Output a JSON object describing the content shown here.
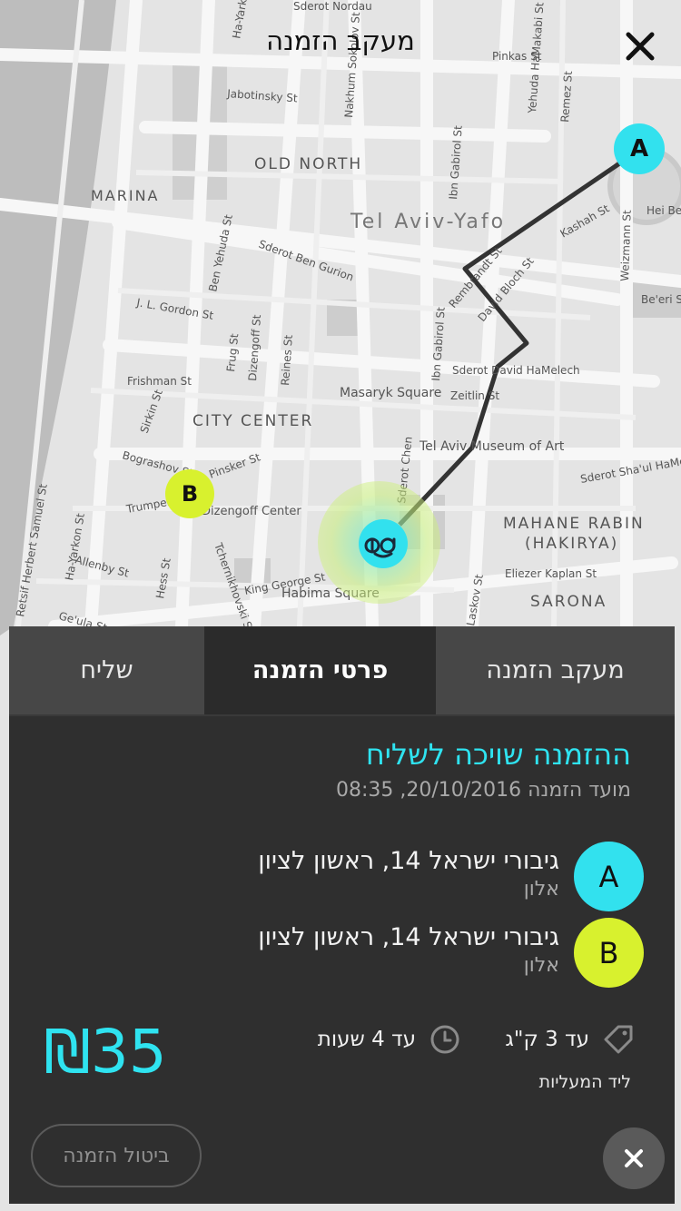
{
  "header": {
    "title": "מעקב הזמנה",
    "close_icon": "close-icon"
  },
  "map": {
    "street_labels": [
      "Ha-Yarkon St",
      "Sderot Nordau",
      "Pinkas St",
      "Jabotinsky St",
      "Nakhum Sokolov St",
      "Remez St",
      "Ibn Gabirol St",
      "Yehuda HaMakabi St",
      "Kashah St",
      "Hei Be'lyar",
      "Sderot Ben Gurion",
      "Ben Yehuda St",
      "J. L. Gordon St",
      "Rembrandt St",
      "David Bloch St",
      "Weizmann St",
      "Be'eri St",
      "Frug St",
      "Dizengoff St",
      "Reines St",
      "Ibn Gabirol St",
      "Sderot David HaMelech",
      "Zeitlin St",
      "Frishman St",
      "Sirkin St",
      "Bograshov St",
      "Pinsker St",
      "Dizengoff Center",
      "Trumpeldor St",
      "Sderot Chen",
      "Sderot Sha'ul HaMelekh",
      "Retsif Herbert Samuel St",
      "Allenby St",
      "Hess St",
      "Tchernikhovski St",
      "King George St",
      "Eliezer Kaplan St",
      "Laskov St",
      "Ge'ula St",
      "Ha-Yarkon St"
    ],
    "district_labels": [
      "OLD NORTH",
      "MARINA",
      "Tel Aviv-Yafo",
      "CITY CENTER",
      "MAHANE RABIN",
      "(HAKIRYA)",
      "SARONA"
    ],
    "poi_labels": [
      "Masaryk Square",
      "Tel Aviv Museum of Art",
      "Habima Square"
    ],
    "marker_a": "A",
    "marker_b": "B",
    "courier_icon": "courier-face-icon",
    "accent_cyan": "#32e1ee",
    "accent_lime": "#d8f12e"
  },
  "tabs": [
    {
      "label": "מעקב הזמנה"
    },
    {
      "label": "פרטי הזמנה",
      "active": true
    },
    {
      "label": "שליח"
    }
  ],
  "order": {
    "status": "ההזמנה שויכה לשליח",
    "time": "מועד הזמנה 20/10/2016, 08:35",
    "stops": [
      {
        "letter": "A",
        "address": "גיבורי ישראל 14, ראשון לציון",
        "name": "אלון"
      },
      {
        "letter": "B",
        "address": "גיבורי ישראל 14, ראשון לציון",
        "name": "אלון"
      }
    ],
    "price": "₪35",
    "weight": "עד 3 ק\"ג",
    "duration": "עד 4 שעות",
    "note": "ליד המעליות",
    "cancel_label": "ביטול הזמנה"
  }
}
